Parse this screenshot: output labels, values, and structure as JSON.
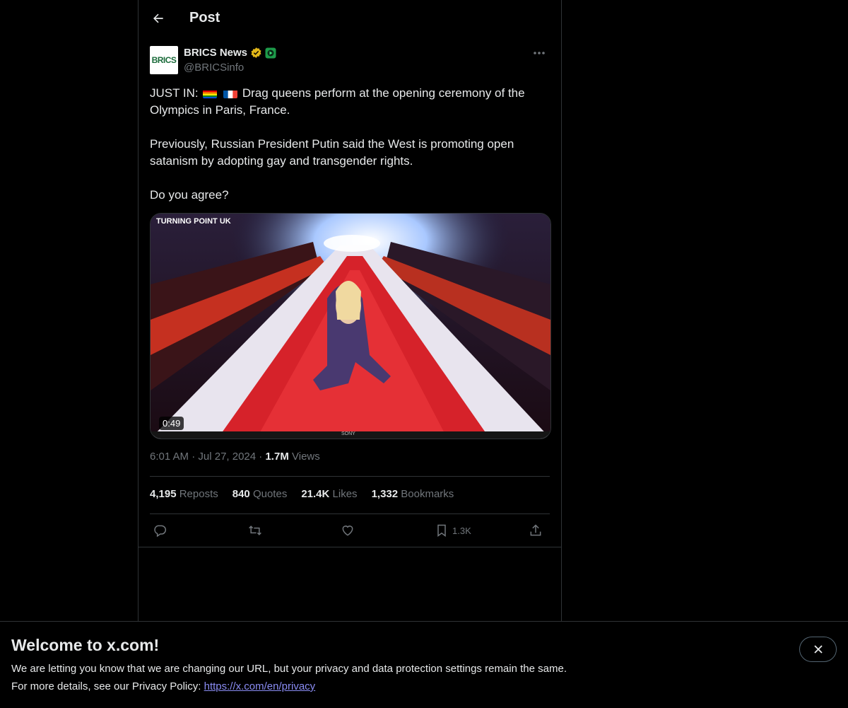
{
  "header": {
    "title": "Post"
  },
  "author": {
    "name": "BRICS News",
    "handle": "@BRICSinfo",
    "avatar_text": "BRICS"
  },
  "tweet": {
    "line1_prefix": "JUST IN:",
    "line1_rest": "Drag queens perform at the opening ceremony of the Olympics in Paris, France.",
    "para2": "Previously, Russian President Putin said the West is promoting open satanism by adopting gay and transgender rights.",
    "para3": "Do you agree?"
  },
  "media": {
    "duration": "0:49",
    "watermark": "TURNING POINT UK",
    "tv_brand": "SONY"
  },
  "meta": {
    "time": "6:01 AM",
    "date": "Jul 27, 2024",
    "views_count": "1.7M",
    "views_label": "Views"
  },
  "stats": {
    "reposts_count": "4,195",
    "reposts_label": "Reposts",
    "quotes_count": "840",
    "quotes_label": "Quotes",
    "likes_count": "21.4K",
    "likes_label": "Likes",
    "bookmarks_count": "1,332",
    "bookmarks_label": "Bookmarks"
  },
  "actions": {
    "bookmark_count": "1.3K"
  },
  "banner": {
    "title": "Welcome to x.com!",
    "line1": "We are letting you know that we are changing our URL, but your privacy and data protection settings remain the same.",
    "line2_prefix": "For more details, see our Privacy Policy:",
    "link": "https://x.com/en/privacy"
  },
  "colors": {
    "background": "#000000",
    "text": "#e7e9ea",
    "muted": "#71767b",
    "border": "#2f3336",
    "verified_gold": "#e2b719",
    "link": "#8a8cf3"
  },
  "icons": [
    "back-arrow-icon",
    "verified-gold-icon",
    "affiliate-badge-icon",
    "more-icon",
    "reply-icon",
    "repost-icon",
    "like-icon",
    "bookmark-icon",
    "share-icon",
    "close-icon",
    "rainbow-flag-icon",
    "france-flag-icon"
  ]
}
